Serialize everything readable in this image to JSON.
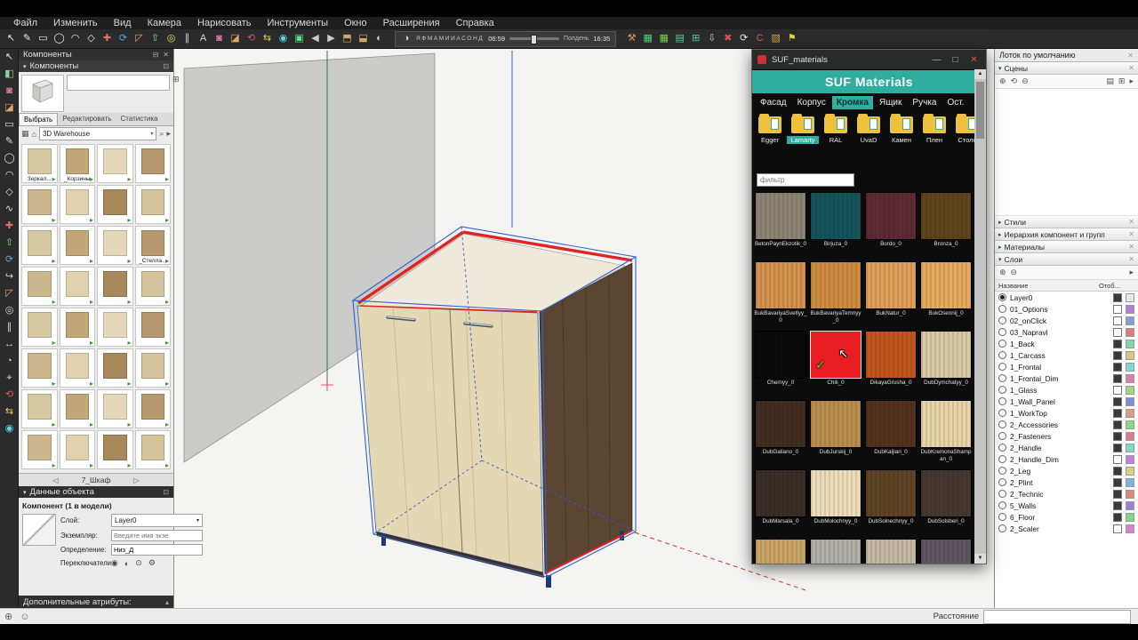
{
  "app": {
    "menu": [
      "Файл",
      "Изменить",
      "Вид",
      "Камера",
      "Нарисовать",
      "Инструменты",
      "Окно",
      "Расширения",
      "Справка"
    ],
    "status": {
      "distance_label": "Расстояние"
    }
  },
  "toolbar": {
    "shadow": {
      "months": "ЯФМАМИИАСОНД",
      "time_start": "06:59",
      "noon_label": "Полдень",
      "time_end": "16:35"
    },
    "icons_left": [
      {
        "name": "select-icon",
        "glyph": "↖",
        "color": "#e8e8e8"
      },
      {
        "name": "line-icon",
        "glyph": "✎",
        "color": "#e8e8e8"
      },
      {
        "name": "rectangle-icon",
        "glyph": "▭",
        "color": "#e8e8e8"
      },
      {
        "name": "circle-icon",
        "glyph": "◯",
        "color": "#e8e8e8"
      },
      {
        "name": "arc-icon",
        "glyph": "◠",
        "color": "#e8e8e8"
      },
      {
        "name": "polygon-icon",
        "glyph": "◇",
        "color": "#e8e8e8"
      },
      {
        "name": "move-icon",
        "glyph": "✚",
        "color": "#e0705a"
      },
      {
        "name": "rotate-icon",
        "glyph": "⟳",
        "color": "#5aaae0"
      },
      {
        "name": "scale-icon",
        "glyph": "◸",
        "color": "#e0a85a"
      },
      {
        "name": "push-pull-icon",
        "glyph": "⇧",
        "color": "#7ae07a"
      },
      {
        "name": "offset-icon",
        "glyph": "◎",
        "color": "#e0e05a"
      },
      {
        "name": "tape-measure-icon",
        "glyph": "∥",
        "color": "#d8d8d8"
      },
      {
        "name": "text-icon",
        "glyph": "A",
        "color": "#d8d8d8"
      },
      {
        "name": "paint-bucket-icon",
        "glyph": "◙",
        "color": "#e07ab0"
      },
      {
        "name": "eraser-icon",
        "glyph": "◪",
        "color": "#e0a85a"
      },
      {
        "name": "orbit-icon",
        "glyph": "⟲",
        "color": "#e05a5a"
      },
      {
        "name": "pan-icon",
        "glyph": "⇆",
        "color": "#e8d25a"
      },
      {
        "name": "zoom-icon",
        "glyph": "◉",
        "color": "#5ad2e8"
      },
      {
        "name": "zoom-extents-icon",
        "glyph": "▣",
        "color": "#5ae87a"
      },
      {
        "name": "previous-view-icon",
        "glyph": "◀",
        "color": "#cccccc"
      },
      {
        "name": "next-view-icon",
        "glyph": "▶",
        "color": "#cccccc"
      },
      {
        "name": "iso-view-icon",
        "glyph": "⬒",
        "color": "#d2a56f"
      },
      {
        "name": "top-view-icon",
        "glyph": "⬓",
        "color": "#d2a56f"
      },
      {
        "name": "shadows-toggle-icon",
        "glyph": "◐",
        "color": "#cccccc"
      }
    ],
    "icons_right": [
      {
        "name": "hammer-icon",
        "glyph": "⚒",
        "color": "#e8954a"
      },
      {
        "name": "cutlist-table-icon",
        "glyph": "▦",
        "color": "#4ad27a"
      },
      {
        "name": "materials-table-icon",
        "glyph": "▦",
        "color": "#7ad24a"
      },
      {
        "name": "report-list-icon",
        "glyph": "▤",
        "color": "#4ad2a0"
      },
      {
        "name": "export-sheet-icon",
        "glyph": "⊞",
        "color": "#4ad27a"
      },
      {
        "name": "import-icon",
        "glyph": "⇩",
        "color": "#cccccc"
      },
      {
        "name": "delete-red-icon",
        "glyph": "✖",
        "color": "#e05050"
      },
      {
        "name": "refresh-icon",
        "glyph": "⟳",
        "color": "#e8e8e8"
      },
      {
        "name": "c-tool-icon",
        "glyph": "C",
        "color": "#e05050"
      },
      {
        "name": "notebook-icon",
        "glyph": "▧",
        "color": "#d2a54a"
      },
      {
        "name": "flag-icon",
        "glyph": "⚑",
        "color": "#e8d24a"
      }
    ]
  },
  "left_toolbar": {
    "tools": [
      {
        "name": "select-tool-icon",
        "glyph": "↖",
        "color": "#e0e0e0"
      },
      {
        "name": "make-component-icon",
        "glyph": "◧",
        "color": "#8ad2a0"
      },
      {
        "name": "paint-bucket-icon",
        "glyph": "◙",
        "color": "#e07ab0"
      },
      {
        "name": "eraser-icon",
        "glyph": "◪",
        "color": "#e0a85a"
      },
      {
        "name": "rectangle-icon",
        "glyph": "▭",
        "color": "#e0e0e0"
      },
      {
        "name": "line-icon",
        "glyph": "✎",
        "color": "#e0e0e0"
      },
      {
        "name": "circle-icon",
        "glyph": "◯",
        "color": "#e0e0e0"
      },
      {
        "name": "arc-icon",
        "glyph": "◠",
        "color": "#e0e0e0"
      },
      {
        "name": "polygon-icon",
        "glyph": "◇",
        "color": "#e0e0e0"
      },
      {
        "name": "freehand-icon",
        "glyph": "∿",
        "color": "#e0e0e0"
      },
      {
        "name": "move-icon",
        "glyph": "✚",
        "color": "#e0705a"
      },
      {
        "name": "push-pull-icon",
        "glyph": "⇧",
        "color": "#7ae07a"
      },
      {
        "name": "rotate-icon",
        "glyph": "⟳",
        "color": "#5aaae0"
      },
      {
        "name": "follow-me-icon",
        "glyph": "↪",
        "color": "#d8d8d8"
      },
      {
        "name": "scale-icon",
        "glyph": "◸",
        "color": "#e0a85a"
      },
      {
        "name": "offset-icon",
        "glyph": "◎",
        "color": "#d8d8d8"
      },
      {
        "name": "tape-measure-icon",
        "glyph": "∥",
        "color": "#d8d8d8"
      },
      {
        "name": "dimension-icon",
        "glyph": "↔",
        "color": "#d8d8d8"
      },
      {
        "name": "protractor-icon",
        "glyph": "◔",
        "color": "#d8d8d8"
      },
      {
        "name": "axes-icon",
        "glyph": "⌖",
        "color": "#d8d8d8"
      },
      {
        "name": "orbit-icon",
        "glyph": "⟲",
        "color": "#e05a5a"
      },
      {
        "name": "pan-icon",
        "glyph": "⇆",
        "color": "#e8d25a"
      },
      {
        "name": "zoom-icon",
        "glyph": "◉",
        "color": "#5ad2e8"
      }
    ]
  },
  "components_panel": {
    "tray_title": "Компоненты",
    "panel_title": "Компоненты",
    "tabs": [
      "Выбрать",
      "Редактировать",
      "Статистика"
    ],
    "active_tab": "Выбрать",
    "search_source": "3D Warehouse",
    "pager_label": "7_Шкаф",
    "thumb_palette": [
      "#d9c9a3",
      "#c2a878",
      "#e4d8ba",
      "#b5986b",
      "#cdb88e",
      "#e0d2ae",
      "#a9895c",
      "#d5c49c"
    ],
    "thumbnails": [
      {
        "label": "Зеркал..."
      },
      {
        "label": "_Корзины"
      },
      {
        "label": ""
      },
      {
        "label": ""
      },
      {
        "label": ""
      },
      {
        "label": ""
      },
      {
        "label": ""
      },
      {
        "label": ""
      },
      {
        "label": ""
      },
      {
        "label": ""
      },
      {
        "label": ""
      },
      {
        "label": "_Стелла..."
      },
      {
        "label": ""
      },
      {
        "label": ""
      },
      {
        "label": ""
      },
      {
        "label": ""
      },
      {
        "label": ""
      },
      {
        "label": ""
      },
      {
        "label": ""
      },
      {
        "label": ""
      },
      {
        "label": ""
      },
      {
        "label": ""
      },
      {
        "label": ""
      },
      {
        "label": ""
      },
      {
        "label": ""
      },
      {
        "label": ""
      },
      {
        "label": ""
      },
      {
        "label": ""
      },
      {
        "label": ""
      },
      {
        "label": ""
      },
      {
        "label": ""
      },
      {
        "label": ""
      }
    ]
  },
  "object_data": {
    "title": "Данные объекта",
    "heading": "Компонент (1 в модели)",
    "layer_label": "Слой:",
    "layer_value": "Layer0",
    "instance_label": "Экземпляр:",
    "instance_placeholder": "Введите имя экзе",
    "definition_label": "Определение:",
    "definition_value": "Низ_Д",
    "toggles_label": "Переключатели:",
    "additional_label": "Дополнительные атрибуты:"
  },
  "viewport": {
    "wall_color": "#cbcbc9",
    "interior_color": "#efe9dc",
    "side_wood_color": "#5a4533",
    "door_wood_color": "#e3d7b4",
    "edge_red": "#e02424",
    "selection_blue": "#2f5fd0",
    "axis_green": "#2e7d2e",
    "axis_blue": "#3a5fd9",
    "axis_red": "#d03030",
    "leg_color": "#1d3a6e"
  },
  "suf_dialog": {
    "window_title": "SUF_materials",
    "header": "SUF Materials",
    "header_color": "#2fae9f",
    "tabs": [
      "Фасад",
      "Корпус",
      "Кромка",
      "Ящик",
      "Ручка",
      "Ост."
    ],
    "active_tab": "Кромка",
    "folders": [
      "Egger",
      "Lamarty",
      "RAL",
      "UvaD",
      "Камен",
      "Плен",
      "Столе"
    ],
    "active_folder": "Lamarty",
    "filter_placeholder": "фильтр",
    "selected_material": "Chili_0",
    "materials": [
      {
        "name": "BetonPaynEkzotik_0",
        "color": "#8d8375"
      },
      {
        "name": "Birjuza_0",
        "color": "#14545c"
      },
      {
        "name": "Bordo_0",
        "color": "#5d2b33"
      },
      {
        "name": "Bronza_0",
        "color": "#5f451b"
      },
      {
        "name": "BukBavariyaSvetlyy_0",
        "color": "#d4924e"
      },
      {
        "name": "BukBavariyaTemnyy_0",
        "color": "#cd8c42"
      },
      {
        "name": "BukNatur_0",
        "color": "#dda05a"
      },
      {
        "name": "BukOsennij_0",
        "color": "#e3ab60"
      },
      {
        "name": "Chernyy_0",
        "color": "#0b0b0b"
      },
      {
        "name": "Chili_0",
        "color": "#e81e22",
        "selected": true
      },
      {
        "name": "DikayaGrusha_0",
        "color": "#c1571f"
      },
      {
        "name": "DubDymchatyy_0",
        "color": "#d8c9a6"
      },
      {
        "name": "DubGaliano_0",
        "color": "#412e20"
      },
      {
        "name": "DubJurskij_0",
        "color": "#ba8e4e"
      },
      {
        "name": "DubKaljiari_0",
        "color": "#55321e"
      },
      {
        "name": "DubKremonaShampan_0",
        "color": "#e7d4aa"
      },
      {
        "name": "DubMarsala_0",
        "color": "#3a2f28"
      },
      {
        "name": "DubMolochnyy_0",
        "color": "#eddcba"
      },
      {
        "name": "DubSolnechnyy_0",
        "color": "#5e4325"
      },
      {
        "name": "DubSolsberi_0",
        "color": "#463831"
      },
      {
        "name": "",
        "color": "#c9a467"
      },
      {
        "name": "",
        "color": "#b0afa6"
      },
      {
        "name": "",
        "color": "#c3b8a2"
      },
      {
        "name": "",
        "color": "#5d5560"
      }
    ]
  },
  "tray": {
    "title": "Лоток по умолчанию",
    "sections": [
      {
        "label": "Сцены"
      },
      {
        "label": "Стили"
      },
      {
        "label": "Иерархия компонент и групп"
      },
      {
        "label": "Материалы"
      },
      {
        "label": "Слои"
      }
    ],
    "layers": {
      "name_col": "Название",
      "visible_col": "Отоб...",
      "items": [
        {
          "name": "Layer0",
          "active": true,
          "visible": true,
          "color": "#e8e8e8"
        },
        {
          "name": "01_Options",
          "active": false,
          "visible": false,
          "color": "#b47ed8"
        },
        {
          "name": "02_onClick",
          "active": false,
          "visible": false,
          "color": "#7ea0d8"
        },
        {
          "name": "03_Napravl",
          "active": false,
          "visible": false,
          "color": "#d87e7e"
        },
        {
          "name": "1_Back",
          "active": false,
          "visible": true,
          "color": "#7ed8a0"
        },
        {
          "name": "1_Carcass",
          "active": false,
          "visible": true,
          "color": "#d8c77e"
        },
        {
          "name": "1_Frontal",
          "active": false,
          "visible": true,
          "color": "#7ed8d3"
        },
        {
          "name": "1_Frontal_Dim",
          "active": false,
          "visible": true,
          "color": "#d87eb4"
        },
        {
          "name": "1_Glass",
          "active": false,
          "visible": false,
          "color": "#a0d87e"
        },
        {
          "name": "1_Wall_Panel",
          "active": false,
          "visible": true,
          "color": "#7e8bd8"
        },
        {
          "name": "1_WorkTop",
          "active": false,
          "visible": true,
          "color": "#d8a07e"
        },
        {
          "name": "2_Accessories",
          "active": false,
          "visible": true,
          "color": "#8bd87e"
        },
        {
          "name": "2_Fasteners",
          "active": false,
          "visible": true,
          "color": "#d87e8b"
        },
        {
          "name": "2_Handle",
          "active": false,
          "visible": true,
          "color": "#7ed8c2"
        },
        {
          "name": "2_Handle_Dim",
          "active": false,
          "visible": false,
          "color": "#c27ed8"
        },
        {
          "name": "2_Leg",
          "active": false,
          "visible": true,
          "color": "#d8d37e"
        },
        {
          "name": "2_Plint",
          "active": false,
          "visible": true,
          "color": "#7eb4d8"
        },
        {
          "name": "2_Technic",
          "active": false,
          "visible": true,
          "color": "#d88b7e"
        },
        {
          "name": "5_Walls",
          "active": false,
          "visible": true,
          "color": "#9a7ed8"
        },
        {
          "name": "6_Floor",
          "active": false,
          "visible": true,
          "color": "#7ed88b"
        },
        {
          "name": "2_Scaler",
          "active": false,
          "visible": false,
          "color": "#d87ed3"
        }
      ]
    }
  }
}
